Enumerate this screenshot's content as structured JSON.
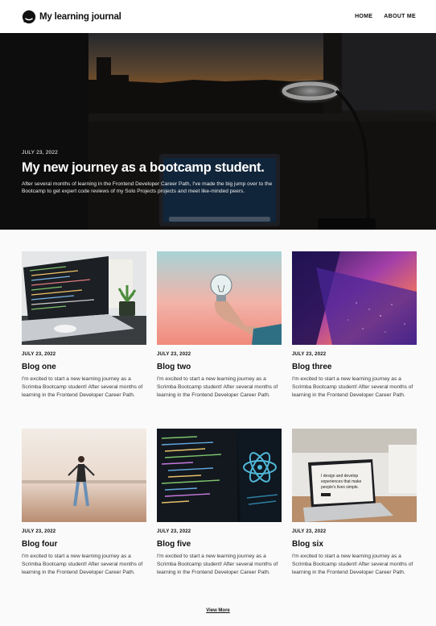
{
  "header": {
    "logo_text": "My learning journal",
    "nav": [
      {
        "label": "HOME"
      },
      {
        "label": "ABOUT ME"
      }
    ]
  },
  "hero": {
    "date": "JULY 23, 2022",
    "title": "My new journey as a bootcamp student.",
    "description": "After several months of learning in the Frontend Developer Career Path, I've made the big jump over to the Bootcamp to get expert code reviews of my Solo Projects projects and meet like-minded peers."
  },
  "posts": [
    {
      "date": "JULY 23, 2022",
      "title": "Blog one",
      "text": "I'm excited to start a new learning journey as a Scrimba Bootcamp student! After several months of learning in the Frontend Developer Career Path."
    },
    {
      "date": "JULY 23, 2022",
      "title": "Blog two",
      "text": "I'm excited to start a new learning journey as a Scrimba Bootcamp student! After several months of learning in the Frontend Developer Career Path."
    },
    {
      "date": "JULY 23, 2022",
      "title": "Blog three",
      "text": "I'm excited to start a new learning journey as a Scrimba Bootcamp student! After several months of learning in the Frontend Developer Career Path."
    },
    {
      "date": "JULY 23, 2022",
      "title": "Blog four",
      "text": "I'm excited to start a new learning journey as a Scrimba Bootcamp student! After several months of learning in the Frontend Developer Career Path."
    },
    {
      "date": "JULY 23, 2022",
      "title": "Blog five",
      "text": "I'm excited to start a new learning journey as a Scrimba Bootcamp student! After several months of learning in the Frontend Developer Career Path."
    },
    {
      "date": "JULY 23, 2022",
      "title": "Blog six",
      "text": "I'm excited to start a new learning journey as a Scrimba Bootcamp student! After several months of learning in the Frontend Developer Career Path."
    }
  ],
  "images": {
    "post_1": "laptop-code-desk",
    "post_2": "lightbulb-hand",
    "post_3": "purple-building",
    "post_4": "girl-on-beach",
    "post_5": "code-screen-react",
    "post_6": "laptop-on-table",
    "laptop_screen_text": "I design and develop experiences that make people's lives simple."
  },
  "view_more": "View More"
}
